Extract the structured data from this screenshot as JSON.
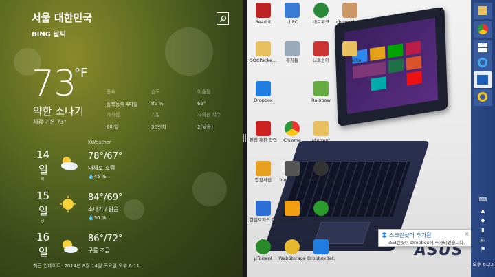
{
  "weather": {
    "location": "서울 대한민국",
    "provider": "BING 날씨",
    "temperature": "73",
    "unit": "°F",
    "condition": "약한 소나기",
    "feels_like": "체감 기온 73°",
    "stats": [
      {
        "label": "풍속",
        "value": "동북동쪽 4마일"
      },
      {
        "label": "습도",
        "value": "80 %"
      },
      {
        "label": "이슬점",
        "value": "66°"
      },
      {
        "label": "가시성",
        "value": "6마일"
      },
      {
        "label": "기압",
        "value": "30인치"
      },
      {
        "label": "자외선 지수",
        "value": "2(낮음)"
      }
    ],
    "forecast_source": "KWeather",
    "forecast": [
      {
        "date": "14",
        "il": "일",
        "dow": "목",
        "hilo": "78°/67°",
        "desc": "대체로 흐림",
        "precip": "45 %"
      },
      {
        "date": "15",
        "il": "일",
        "dow": "금",
        "hilo": "84°/69°",
        "desc": "소나기 / 맑음",
        "precip": "30 %"
      },
      {
        "date": "16",
        "il": "일",
        "dow": "",
        "hilo": "86°/72°",
        "desc": "구름 조금",
        "precip": ""
      }
    ],
    "updated": "최근 업데이트: 2014년 8월 14일 목요일 오후 6:11"
  },
  "desktop": {
    "icons": [
      {
        "label": "Read It",
        "color": "#b22"
      },
      {
        "label": "내 PC",
        "color": "#3a7bd5"
      },
      {
        "label": "네트워크",
        "color": "#2a8a3a"
      },
      {
        "label": "chromebook",
        "color": "#c96"
      },
      {
        "label": "SOCPacke...",
        "color": "#e8c060"
      },
      {
        "label": "휴지통",
        "color": "#9ab"
      },
      {
        "label": "니트용어",
        "color": "#c33"
      },
      {
        "label": "SOCPacka",
        "color": "#e8c060"
      },
      {
        "label": "Dropbox",
        "color": "#1f7de0"
      },
      {
        "label": "Rainbow",
        "color": "#6a4"
      },
      {
        "label": "편집 재판 작업",
        "color": "#c22"
      },
      {
        "label": "Chrome",
        "color": "#e33"
      },
      {
        "label": "utorrent",
        "color": "#e8c060"
      },
      {
        "label": "한컴사전",
        "color": "#e7a020"
      },
      {
        "label": "foobar2000",
        "color": "#555"
      },
      {
        "label": "MelOn Player4",
        "color": "#333"
      },
      {
        "label": "한컴오피스 한글 2010",
        "color": "#2b6fd6"
      },
      {
        "label": "Samsung Kies 3",
        "color": "#f2a012"
      },
      {
        "label": "MelOn",
        "color": "#2a9a2a"
      },
      {
        "label": "µTorrent",
        "color": "#2a8a2a"
      },
      {
        "label": "WebStorage",
        "color": "#e6b830"
      },
      {
        "label": "DropboxBat...",
        "color": "#1f7de0"
      }
    ],
    "brand": "ASUS"
  },
  "notification": {
    "title": "스크린샷이 추가됨",
    "body": "스크린샷이 Dropbox에 추가되었습니다."
  },
  "taskbar": {
    "time": "오후 6:22"
  }
}
